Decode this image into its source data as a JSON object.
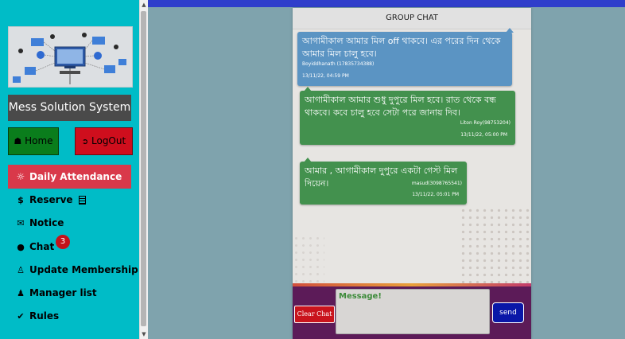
{
  "sidebar": {
    "brand": "Mess Solution System",
    "home_label": "Home",
    "logout_label": "LogOut",
    "active_item": "Daily Attendance",
    "items": [
      {
        "label": "Reserve",
        "icon": "dollar-icon"
      },
      {
        "label": "Notice",
        "icon": "megaphone-icon"
      },
      {
        "label": "Chat",
        "icon": "comment-icon",
        "badge": "3"
      },
      {
        "label": "Update Membership",
        "icon": "user-plus-icon"
      },
      {
        "label": "Manager list",
        "icon": "users-icon"
      },
      {
        "label": "Rules",
        "icon": "check-circle-icon"
      }
    ]
  },
  "chat": {
    "title": "GROUP CHAT",
    "messages": [
      {
        "text": "আগামীকাল আমার মিল off থাকবে। এর পরের দিন থেকে আমার মিল চালু হবে।",
        "sender": "Boyiddhanath (17835734388)",
        "time": "13/11/22, 04:59 PM",
        "color": "#5b94c3"
      },
      {
        "text": "আগামীকাল আমার শুধু দুপুরে মিল হবে। রাত থেকে বন্ধ থাকবে। কবে চালু হবে সেটা পরে জানায় দিব।",
        "sender": "Liton Roy(98753204)",
        "time": "13/11/22, 05:00 PM",
        "color": "#43914e"
      },
      {
        "text": "আমার , আগামীকাল দুপুরে একটা গেস্ট মিল দিয়েন।",
        "sender": "masud(3098765541)",
        "time": "13/11/22, 05:01 PM",
        "color": "#43914e"
      }
    ],
    "clear_label": "Clear Chat",
    "input_placeholder": "Message!",
    "send_label": "send"
  },
  "colors": {
    "sidebar_bg": "#00bcc7",
    "topbar": "#2f3ecb",
    "active_nav": "#d9394a",
    "home_btn": "#0a7d1c",
    "logout_btn": "#cf0e1d",
    "chat_footer": "#5c1b58"
  }
}
